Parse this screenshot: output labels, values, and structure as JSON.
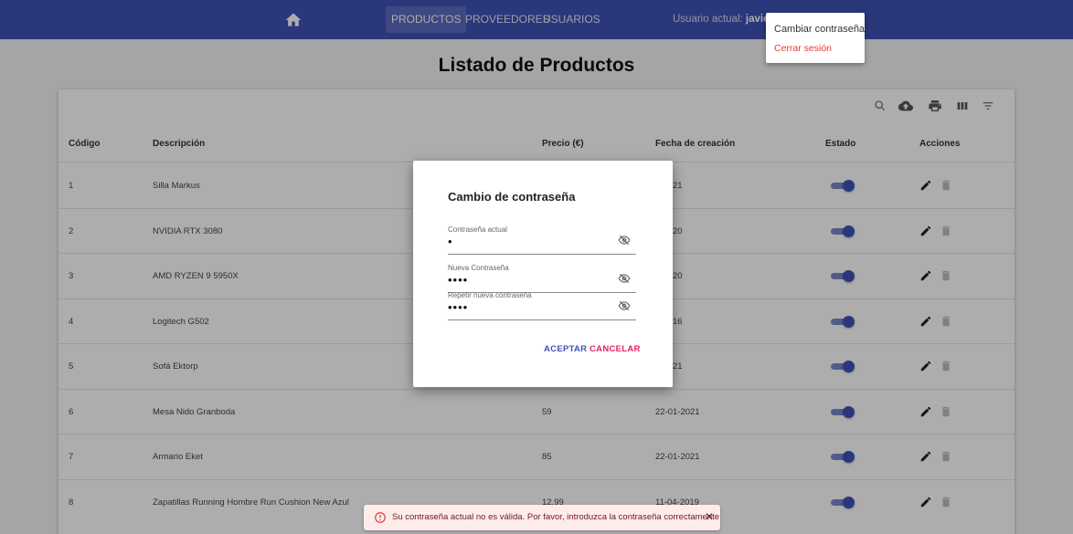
{
  "navbar": {
    "home_icon": "home-icon",
    "links": [
      {
        "label": "PRODUCTOS",
        "active": true
      },
      {
        "label": "PROVEEDORES",
        "active": false
      },
      {
        "label": "USUARIOS",
        "active": false
      }
    ],
    "user_prefix": "Usuario actual: ",
    "user_name": "javierim",
    "bg_color": "#3f51b5"
  },
  "user_menu": {
    "change_password": "Cambiar contraseña",
    "logout": "Cerrar sesión"
  },
  "page": {
    "title": "Listado de Productos"
  },
  "toolbar": {
    "icons": [
      "search-icon",
      "cloud-upload-icon",
      "print-icon",
      "columns-icon",
      "filter-icon"
    ]
  },
  "table": {
    "columns": [
      "Código",
      "Descripción",
      "Precio (€)",
      "Fecha de creación",
      "Estado",
      "Acciones"
    ],
    "rows": [
      {
        "code": "1",
        "description": "Silla Markus",
        "price": "",
        "date": "1-2021",
        "active": true
      },
      {
        "code": "2",
        "description": "NVIDIA RTX 3080",
        "price": "",
        "date": "8-2020",
        "active": true
      },
      {
        "code": "3",
        "description": "AMD RYZEN 9 5950X",
        "price": "",
        "date": "8-2020",
        "active": true
      },
      {
        "code": "4",
        "description": "Logitech G502",
        "price": "",
        "date": "8-2016",
        "active": true
      },
      {
        "code": "5",
        "description": "Sofá Ektorp",
        "price": "",
        "date": "1-2021",
        "active": true
      },
      {
        "code": "6",
        "description": "Mesa Nido Granboda",
        "price": "59",
        "date": "22-01-2021",
        "active": true
      },
      {
        "code": "7",
        "description": "Armario Eket",
        "price": "85",
        "date": "22-01-2021",
        "active": true
      },
      {
        "code": "8",
        "description": "Zapatillas Running Hombre Run Cushion New Azul",
        "price": "12.99",
        "date": "11-04-2019",
        "active": true
      }
    ]
  },
  "dialog": {
    "title": "Cambio de contraseña",
    "fields": [
      {
        "label": "Contraseña actual",
        "value": "•"
      },
      {
        "label": "Nueva Contraseña",
        "value": "••••"
      },
      {
        "label": "Repetir nueva contraseña",
        "value": "••••"
      }
    ],
    "accept_label": "ACEPTAR",
    "cancel_label": "CANCELAR",
    "accept_color": "#3f51b5",
    "cancel_color": "#e91e63"
  },
  "snackbar": {
    "message": "Su contraseña actual no es válida. Por favor, introduzca la contraseña correctamente",
    "close_label": "✕",
    "severity_color": "#e53935"
  }
}
